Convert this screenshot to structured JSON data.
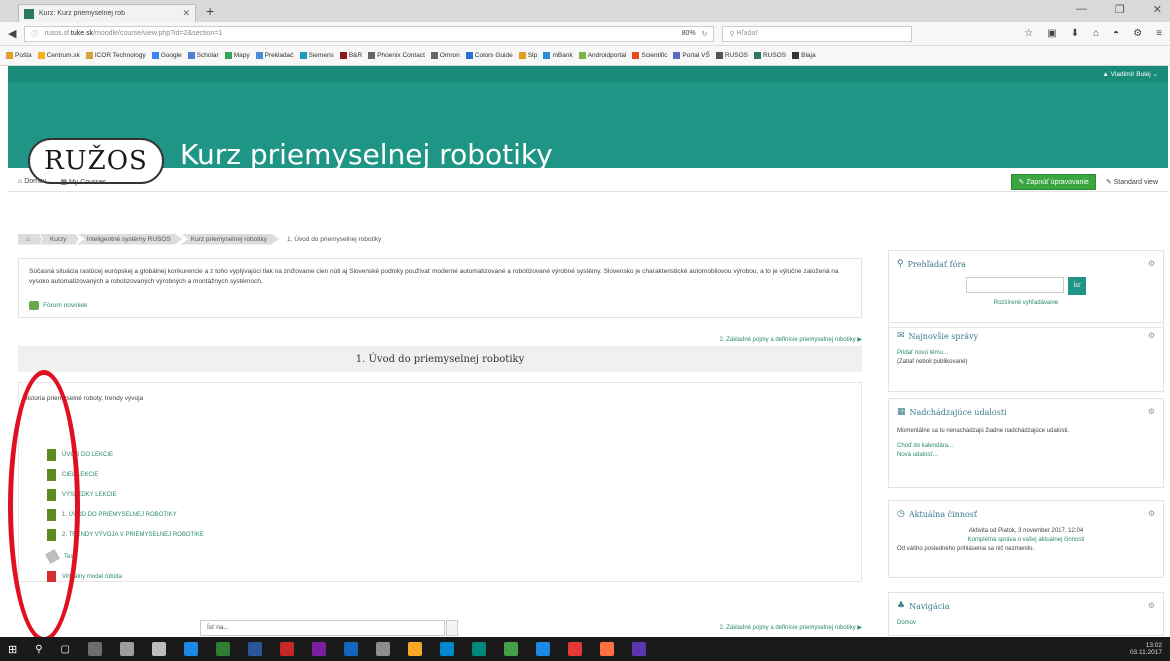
{
  "browser": {
    "tab_title": "Kurz: Kurz priemyselnej rob",
    "url_prefix": "rusos.sf.",
    "url_host": "tuke.sk",
    "url_rest": "/moodle/course/view.php?id=2&section=1",
    "zoom": "80%",
    "search_placeholder": "Hľadať",
    "bookmarks": [
      {
        "label": "Pošta",
        "color": "#e0a030"
      },
      {
        "label": "Centrum.sk",
        "color": "#f2b01e"
      },
      {
        "label": "ICOR Technology",
        "color": "#d8a040"
      },
      {
        "label": "Google",
        "color": "#4285f4"
      },
      {
        "label": "Scholar",
        "color": "#4a7fd4"
      },
      {
        "label": "Mapy",
        "color": "#34a853"
      },
      {
        "label": "Prekladač",
        "color": "#4a90d9"
      },
      {
        "label": "Siemens",
        "color": "#1a9abc"
      },
      {
        "label": "B&R",
        "color": "#8a1a1a"
      },
      {
        "label": "Phoenix Contact",
        "color": "#666666"
      },
      {
        "label": "Omron",
        "color": "#666666"
      },
      {
        "label": "Colors Guide",
        "color": "#2a6fc9"
      },
      {
        "label": "Stp",
        "color": "#e0a020"
      },
      {
        "label": "mBank",
        "color": "#2a8fd0"
      },
      {
        "label": "Androidportal",
        "color": "#7cb342"
      },
      {
        "label": "Scientific",
        "color": "#e64a19"
      },
      {
        "label": "Portal VŠ",
        "color": "#5c6bc0"
      },
      {
        "label": "RUSOS",
        "color": "#555555"
      },
      {
        "label": "RUSOS",
        "color": "#2a7a5b"
      },
      {
        "label": "Blaja",
        "color": "#333333"
      }
    ]
  },
  "moodle": {
    "user": "Vladimír Bulej",
    "logo_text": "RUŽOS",
    "site_title": "Kurz priemyselnej robotiky",
    "menu": {
      "home": "Domov",
      "courses": "My Courses"
    },
    "edit_button": "Zapnúť úpravovanie",
    "view_mode": "Standard view",
    "breadcrumb": [
      "⌂",
      "Kurzy",
      "Inteligentné systémy RUSOS",
      "Kurz priemyselnej robotiky",
      "1. Úvod do priemyselnej robotiky"
    ]
  },
  "main": {
    "intro": "Súčasná situácia rastúcej európskej a globálnej konkurencie a z toho vyplývajúci tlak na znižovanie cien núti aj Slovenské podniky používať moderné automatizované a robotizované výrobné systémy. Slovensko je charakteristické automobilovou výrobou, a to je výlučne založená na vysoko automatizovaných a robotizovaných výrobných a montážnych systémoch.",
    "forum_link": "Fórum noviniek",
    "next_section": "2. Základné pojmy a definície priemyselnej robotiky ▶",
    "section_title": "1. Úvod do priemyselnej robotiky",
    "section_summary": "Historia priemyselné roboty, trendy vývoja",
    "activities": [
      {
        "label": "ÚVOD DO LEKCIE",
        "icon": "book-icon"
      },
      {
        "label": "CIEĽ LEKCIE",
        "icon": "book-icon"
      },
      {
        "label": "VÝSLEDKY LEKCIE",
        "icon": "book-icon"
      },
      {
        "label": "1. ÚVOD DO PRIEMYSELNEJ ROBOTIKY",
        "icon": "book-icon"
      },
      {
        "label": "2. TRENDY VÝVOJA V PRIEMYSELNEJ ROBOTIKE",
        "icon": "book-icon"
      },
      {
        "label": "Test",
        "icon": "pencil-icon"
      },
      {
        "label": "Virtuálny model robota",
        "icon": "pdf-icon"
      }
    ],
    "jump_to": "Ísť na...",
    "next_section_bottom": "2. Základné pojmy a definície priemyselnej robotiky ▶"
  },
  "blocks": {
    "search": {
      "title": "Prehľadať fóra",
      "go": "Ísť",
      "advanced": "Rozšírené vyhľadávanie"
    },
    "news": {
      "title": "Najnovšie správy",
      "add": "Pridať novú tému...",
      "none": "(Zatiaľ neboli publikované)"
    },
    "upcoming": {
      "title": "Nadchádzajúce udalosti",
      "text": "Momentálne sa tu nenachádzajú žiadne nadchádzajúce udalosti.",
      "link1": "Choď do kalendára...",
      "link2": "Nová udalosť..."
    },
    "recent": {
      "title": "Aktuálna činnosť",
      "since": "Aktivita od Piatok, 3 november 2017, 12:04",
      "full": "Kompletná správa o vašej aktuálnej činnosti",
      "none": "Od vášho posledného prihlásenia sa nič nezmenilo."
    },
    "navigation": {
      "title": "Navigácia",
      "home": "Domov"
    }
  },
  "taskbar": {
    "time": "13:02",
    "date": "03.11.2017"
  }
}
